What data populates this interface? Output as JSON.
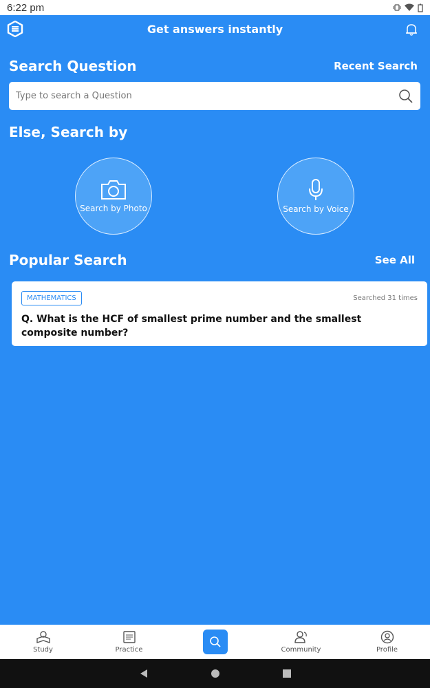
{
  "status": {
    "time": "6:22 pm"
  },
  "header": {
    "title": "Get answers instantly"
  },
  "search_section": {
    "title": "Search Question",
    "recent_link": "Recent Search",
    "placeholder": "Type to search a Question"
  },
  "else_section": {
    "title": "Else, Search by",
    "photo_label": "Search by Photo",
    "voice_label": "Search by Voice"
  },
  "popular": {
    "title": "Popular Search",
    "see_all": "See All",
    "items": [
      {
        "tag": "MATHEMATICS",
        "count": "Searched 31 times",
        "question": "Q. What is the HCF of smallest prime number and the smallest composite number?"
      }
    ]
  },
  "nav": {
    "items": [
      {
        "label": "Study",
        "icon": "study-icon"
      },
      {
        "label": "Practice",
        "icon": "practice-icon"
      },
      {
        "label": "",
        "icon": "search-icon"
      },
      {
        "label": "Community",
        "icon": "community-icon"
      },
      {
        "label": "Profile",
        "icon": "profile-icon"
      }
    ]
  },
  "colors": {
    "accent": "#2a8cf4",
    "white": "#ffffff"
  }
}
